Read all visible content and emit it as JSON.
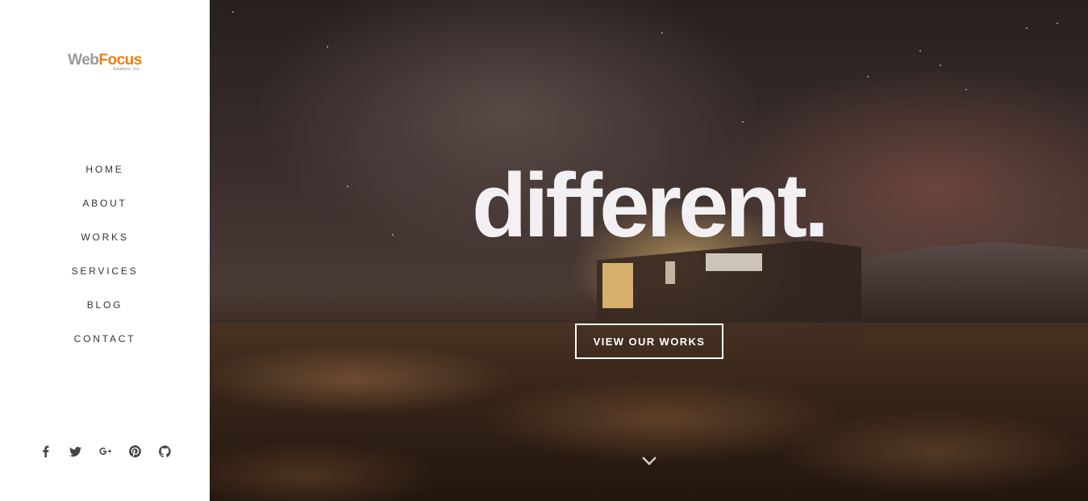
{
  "brand": {
    "logo_primary": "Web",
    "logo_accent": "Focus",
    "logo_sub": "Solutions, Inc.",
    "accent_color": "#f07d10",
    "primary_color": "#9a9a9a"
  },
  "sidebar": {
    "nav": [
      {
        "label": "HOME"
      },
      {
        "label": "ABOUT"
      },
      {
        "label": "WORKS"
      },
      {
        "label": "SERVICES"
      },
      {
        "label": "BLOG"
      },
      {
        "label": "CONTACT"
      }
    ],
    "social": [
      {
        "icon": "facebook-icon"
      },
      {
        "icon": "twitter-icon"
      },
      {
        "icon": "google-plus-icon"
      },
      {
        "icon": "pinterest-icon"
      },
      {
        "icon": "github-icon"
      }
    ]
  },
  "hero": {
    "title": "different.",
    "cta_label": "VIEW OUR WORKS",
    "scroll_icon": "chevron-down-icon"
  }
}
